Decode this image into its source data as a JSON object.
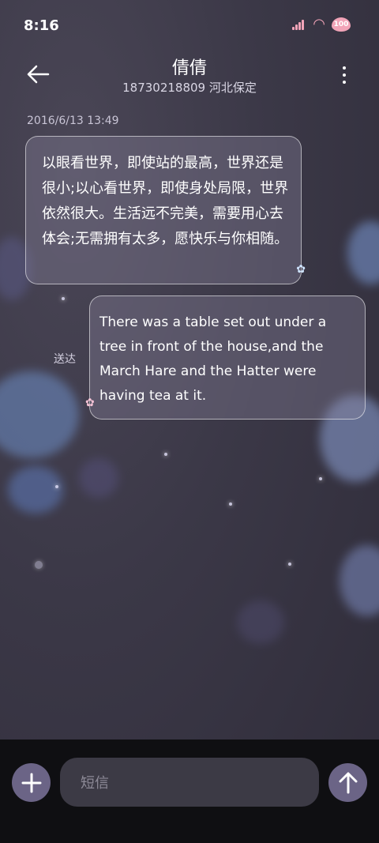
{
  "status_bar": {
    "time": "8:16",
    "battery_level": "100",
    "signal_icon": "signal-icon",
    "wifi_icon": "wifi-icon",
    "battery_icon": "battery-heart-icon",
    "accent_color": "#f2a4b8"
  },
  "header": {
    "contact_name": "倩倩",
    "contact_sub": "18730218809 河北保定",
    "back_icon": "arrow-left-icon",
    "more_icon": "more-vertical-icon"
  },
  "conversation": {
    "date": "2016/6/13 13:49",
    "messages": [
      {
        "direction": "incoming",
        "text": "以眼看世界，即使站的最高，世界还是很小;以心看世界，即使身处局限，世界依然很大。生活远不完美，需要用心去体会;无需拥有太多，愿快乐与你相随。"
      },
      {
        "direction": "outgoing",
        "text": "There was a table set out under a tree in front of the house,and the March Hare and the Hatter were having tea at it.",
        "status": "送达"
      }
    ]
  },
  "composer": {
    "add_icon": "plus-icon",
    "placeholder": "短信",
    "send_icon": "arrow-up-icon",
    "button_color": "#6b6486"
  }
}
